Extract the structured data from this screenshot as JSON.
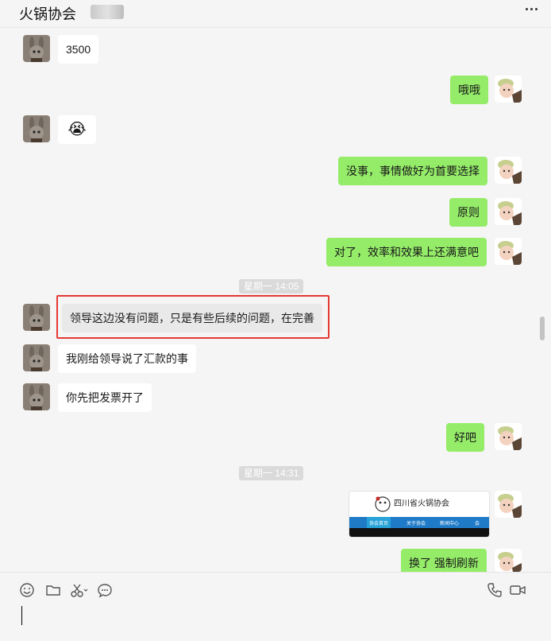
{
  "header": {
    "title": "火锅协会",
    "more_icon": "more-dots-icon"
  },
  "messages": [
    {
      "side": "in",
      "text": "3500"
    },
    {
      "side": "out",
      "text": "哦哦"
    },
    {
      "side": "in",
      "emoji": "😭"
    },
    {
      "side": "out",
      "text": "没事，事情做好为首要选择"
    },
    {
      "side": "out",
      "text": "原则"
    },
    {
      "side": "out",
      "text": "对了，效率和效果上还满意吧"
    },
    {
      "side": "in",
      "text": "领导这边没有问题，只是有些后续的问题，在完善",
      "highlighted": true
    },
    {
      "side": "in",
      "text": "我刚给领导说了汇款的事"
    },
    {
      "side": "in",
      "text": "你先把发票开了"
    },
    {
      "side": "out",
      "text": "好吧"
    },
    {
      "side": "out",
      "image": "website-screenshot"
    },
    {
      "side": "out",
      "text": "换了 强制刷新"
    }
  ],
  "timestamps": [
    "星期一 14:05",
    "星期一 14:31"
  ],
  "image_card": {
    "brand_text": "四川省火锅协会",
    "nav": [
      "协会首页",
      "关于协会",
      "新闻中心",
      "会"
    ]
  },
  "composer": {
    "tools": [
      "emoji-icon",
      "folder-icon",
      "scissors-icon",
      "chat-history-icon"
    ],
    "right_tools": [
      "phone-icon",
      "video-icon"
    ]
  },
  "colors": {
    "out_bubble": "#95ec69",
    "in_bubble": "#ffffff",
    "highlight": "#e53935"
  }
}
